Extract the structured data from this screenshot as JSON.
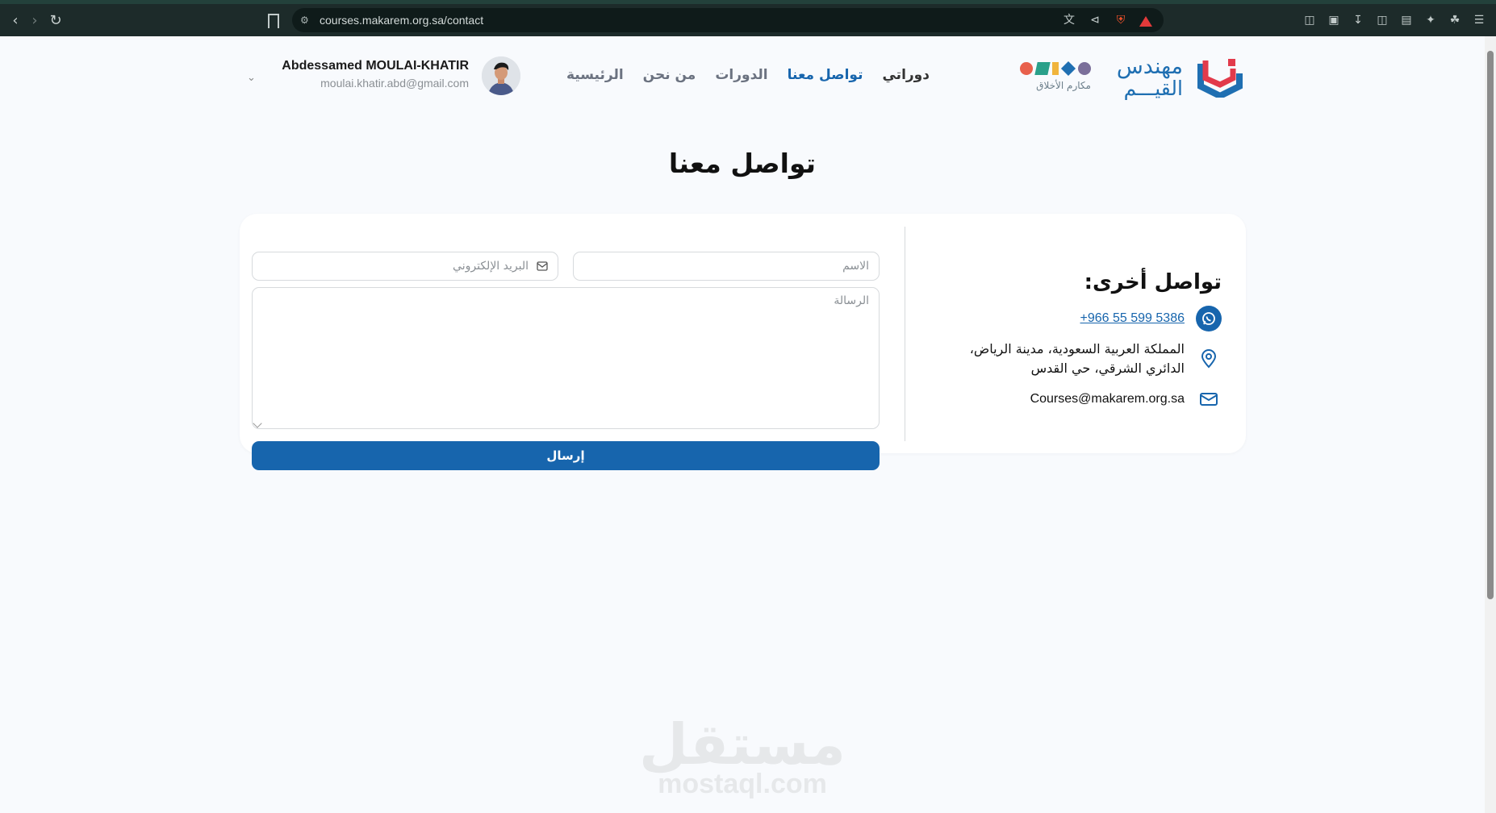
{
  "browser": {
    "url": "courses.makarem.org.sa/contact"
  },
  "header": {
    "logo": {
      "line1": "مهندس",
      "line2": "القيـــم",
      "subbrand": "مكارم الأخلاق",
      "colors": [
        "#7b6f9a",
        "#1f6fb2",
        "#f0b43c",
        "#2aa08a",
        "#e8604c"
      ]
    },
    "nav": [
      {
        "label": "الرئيسية",
        "state": "normal"
      },
      {
        "label": "من نحن",
        "state": "normal"
      },
      {
        "label": "الدورات",
        "state": "normal"
      },
      {
        "label": "تواصل معنا",
        "state": "active"
      },
      {
        "label": "دوراتي",
        "state": "bold"
      }
    ],
    "user": {
      "name": "Abdessamed MOULAI-KHATIR",
      "email": "moulai.khatir.abd@gmail.com"
    }
  },
  "page_title": "تواصل معنا",
  "contact": {
    "heading": "تواصل أخرى:",
    "phone": "+966 55 599 5386",
    "address": "المملكة العربية السعودية، مدينة الرياض، الدائري الشرقي، حي القدس",
    "email": "Courses@makarem.org.sa"
  },
  "form": {
    "name_placeholder": "الاسم",
    "email_placeholder": "البريد الإلكتروني",
    "message_placeholder": "الرسالة",
    "submit_label": "إرسال"
  },
  "watermark": {
    "arabic": "مستقل",
    "latin": "mostaql.com"
  },
  "colors": {
    "primary": "#1765ad",
    "page_bg": "#f8fafd"
  }
}
